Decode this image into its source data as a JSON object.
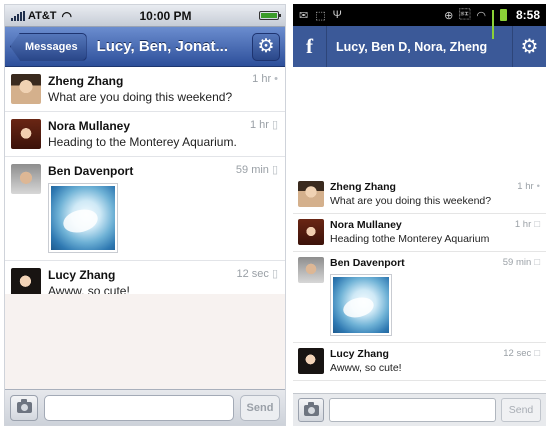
{
  "ios": {
    "status": {
      "carrier": "AT&T",
      "time": "10:00 PM"
    },
    "nav": {
      "back_label": "Messages",
      "title": "Lucy, Ben, Jonat...",
      "settings_icon": "gear-icon"
    },
    "messages": [
      {
        "name": "Zheng Zhang",
        "text": "What are you doing this weekend?",
        "time": "1 hr",
        "source_icon": "location-pin-icon"
      },
      {
        "name": "Nora Mullaney",
        "text": "Heading to the Monterey Aquarium.",
        "time": "1 hr",
        "source_icon": "mobile-icon"
      },
      {
        "name": "Ben Davenport",
        "text": "",
        "time": "59 min",
        "source_icon": "mobile-icon",
        "attachment": "beluga-photo"
      },
      {
        "name": "Lucy Zhang",
        "text": "Awww, so cute!",
        "time": "12 sec",
        "source_icon": "mobile-icon"
      }
    ],
    "composer": {
      "input_value": "",
      "send_label": "Send",
      "camera_icon": "camera-icon"
    }
  },
  "android": {
    "status": {
      "time": "8:58"
    },
    "nav": {
      "logo": "f",
      "title": "Lucy, Ben D, Nora, Zheng",
      "settings_icon": "gear-icon"
    },
    "messages": [
      {
        "name": "Zheng Zhang",
        "text": "What are you doing this weekend?",
        "time": "1 hr",
        "source_icon": "location-pin-icon"
      },
      {
        "name": "Nora Mullaney",
        "text": "Heading tothe Monterey Aquarium",
        "time": "1 hr",
        "source_icon": "chat-bubble-icon"
      },
      {
        "name": "Ben Davenport",
        "text": "",
        "time": "59 min",
        "source_icon": "chat-bubble-icon",
        "attachment": "beluga-photo"
      },
      {
        "name": "Lucy Zhang",
        "text": "Awww, so cute!",
        "time": "12 sec",
        "source_icon": "chat-bubble-icon"
      }
    ],
    "composer": {
      "input_value": "",
      "send_label": "Send",
      "camera_icon": "camera-icon"
    }
  },
  "colors": {
    "ios_nav": "#2d4f9a",
    "facebook_blue": "#3b5998",
    "timestamp_gray": "#9aa0a6"
  }
}
